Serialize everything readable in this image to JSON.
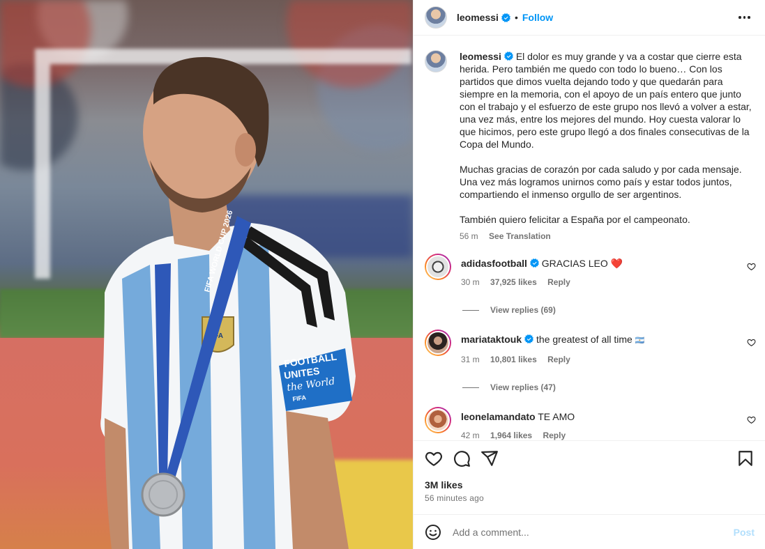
{
  "post": {
    "username": "leomessi",
    "follow_label": "Follow",
    "dot": "•",
    "caption": "El dolor es muy grande y va a costar que cierre esta herida. Pero también me quedo con todo lo bueno… Con los partidos que dimos vuelta dejando todo y que quedarán para siempre en la memoria, con el apoyo de un país entero que junto con el trabajo y el esfuerzo de este grupo nos llevó a volver a estar, una vez más, entre los mejores del mundo. Hoy cuesta valorar lo que hicimos, pero este grupo llegó a dos finales consecutivas de la Copa del Mundo.\n\nMuchas gracias de corazón por cada saludo y por cada mensaje. Una vez más logramos unirnos como país y estar todos juntos, compartiendo el inmenso orgullo de ser argentinos.\n\nTambién quiero felicitar a España por el campeonato.",
    "caption_time": "56 m",
    "see_translation": "See Translation",
    "likes": "3M likes",
    "time_ago": "56 minutes ago"
  },
  "image_text": {
    "lanyard": "FIFA WORLD CUP 2026",
    "armband_line1": "FOOTBALL",
    "armband_line2": "UNITES",
    "armband_line3": "the World",
    "armband_fifa": "FIFA",
    "jersey_badge": "AFA"
  },
  "comments": [
    {
      "username": "adidasfootball",
      "verified": true,
      "text": "GRACIAS LEO",
      "emoji": "❤️",
      "time": "30 m",
      "likes": "37,925 likes",
      "reply": "Reply",
      "view_replies": "View replies (69)"
    },
    {
      "username": "mariataktouk",
      "verified": true,
      "text": "the greatest of all time",
      "emoji": "🇦🇷",
      "time": "31 m",
      "likes": "10,801 likes",
      "reply": "Reply",
      "view_replies": "View replies (47)"
    },
    {
      "username": "leonelamandato",
      "verified": false,
      "text": "TE AMO",
      "emoji": "",
      "time": "42 m",
      "likes": "1,964 likes",
      "reply": "Reply"
    }
  ],
  "add_comment": {
    "placeholder": "Add a comment...",
    "post_label": "Post"
  },
  "icons": [
    "more-options-icon",
    "verified-badge-icon",
    "heart-icon",
    "comment-icon",
    "share-icon",
    "save-icon",
    "emoji-icon"
  ],
  "colors": {
    "follow_blue": "#0095f6",
    "post_disabled": "#b2dffc",
    "verified_blue": "#0095f6",
    "jersey_blue": "#75aadb"
  }
}
